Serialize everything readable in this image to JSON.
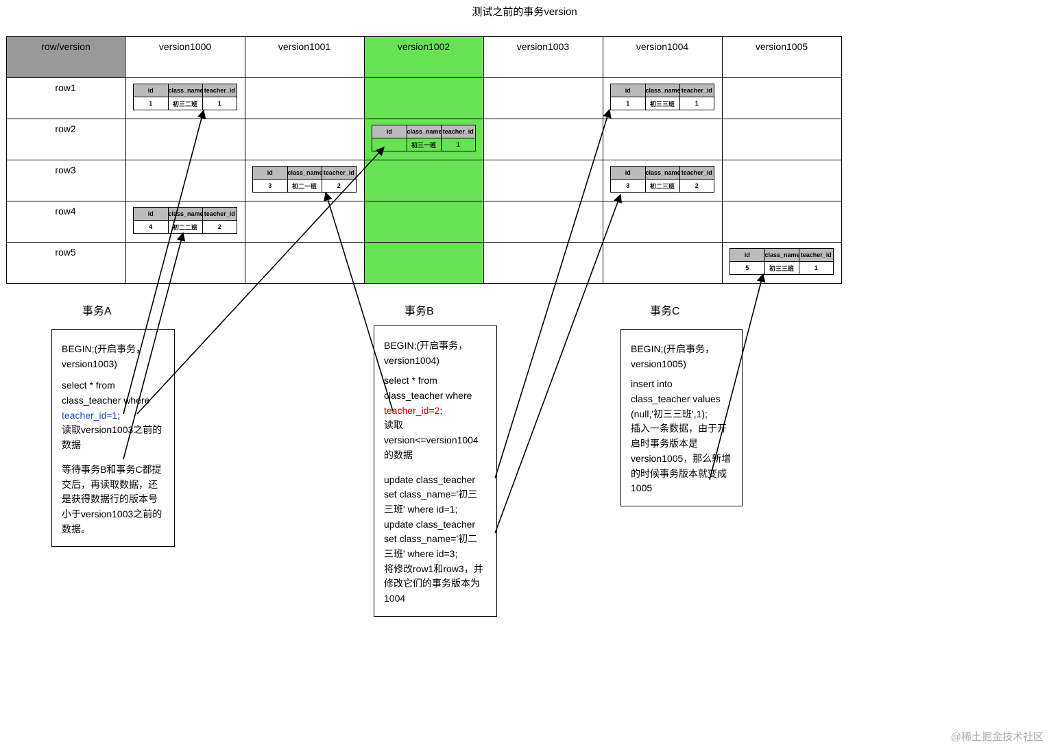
{
  "title": "测试之前的事务version",
  "headers": {
    "rowver": "row/version",
    "v1000": "version1000",
    "v1001": "version1001",
    "v1002": "version1002",
    "v1003": "version1003",
    "v1004": "version1004",
    "v1005": "version1005"
  },
  "rows": {
    "r1": "row1",
    "r2": "row2",
    "r3": "row3",
    "r4": "row4",
    "r5": "row5"
  },
  "mini_headers": {
    "id": "id",
    "class_name": "class_name",
    "teacher_id": "teacher_id"
  },
  "mini": {
    "r1_v1000": {
      "id": "1",
      "cls": "初三二班",
      "tid": "1"
    },
    "r2_v1002": {
      "id": "",
      "cls": "初三一班",
      "tid": "1"
    },
    "r3_v1001": {
      "id": "3",
      "cls": "初二一班",
      "tid": "2"
    },
    "r4_v1000": {
      "id": "4",
      "cls": "初二二班",
      "tid": "2"
    },
    "r1_v1004": {
      "id": "1",
      "cls": "初三三班",
      "tid": "1"
    },
    "r3_v1004": {
      "id": "3",
      "cls": "初二三班",
      "tid": "2"
    },
    "r5_v1005": {
      "id": "5",
      "cls": "初三三班",
      "tid": "1"
    }
  },
  "tx": {
    "A": {
      "label": "事务A",
      "l1": "BEGIN;(开启事务，version1003)",
      "l2": "select * from class_teacher where ",
      "l2_hl": "teacher_id=1",
      "l2_tail": ";",
      "l3": "读取version1003之前的数据",
      "l4": "等待事务B和事务C都提交后，再读取数据，还是获得数据行的版本号小于version1003之前的数据。"
    },
    "B": {
      "label": "事务B",
      "l1": "BEGIN;(开启事务，version1004)",
      "l2a": " select * from class_teacher where ",
      "l2_hl": "teacher_id=2",
      "l2_tail": ";",
      "l3": "读取version<=version1004的数据",
      "l4": "update class_teacher set class_name='初三三班' where id=1;",
      "l5": "update class_teacher set class_name='初二三班' where id=3;",
      "l6": "将修改row1和row3，并修改它们的事务版本为1004"
    },
    "C": {
      "label": "事务C",
      "l1": "BEGIN;(开启事务，version1005)",
      "l2": "insert into class_teacher values (null,'初三三班',1);",
      "l3": "插入一条数据，由于开启时事务版本是version1005，那么新增的时候事务版本就变成1005"
    }
  },
  "watermark": "@稀土掘金技术社区"
}
